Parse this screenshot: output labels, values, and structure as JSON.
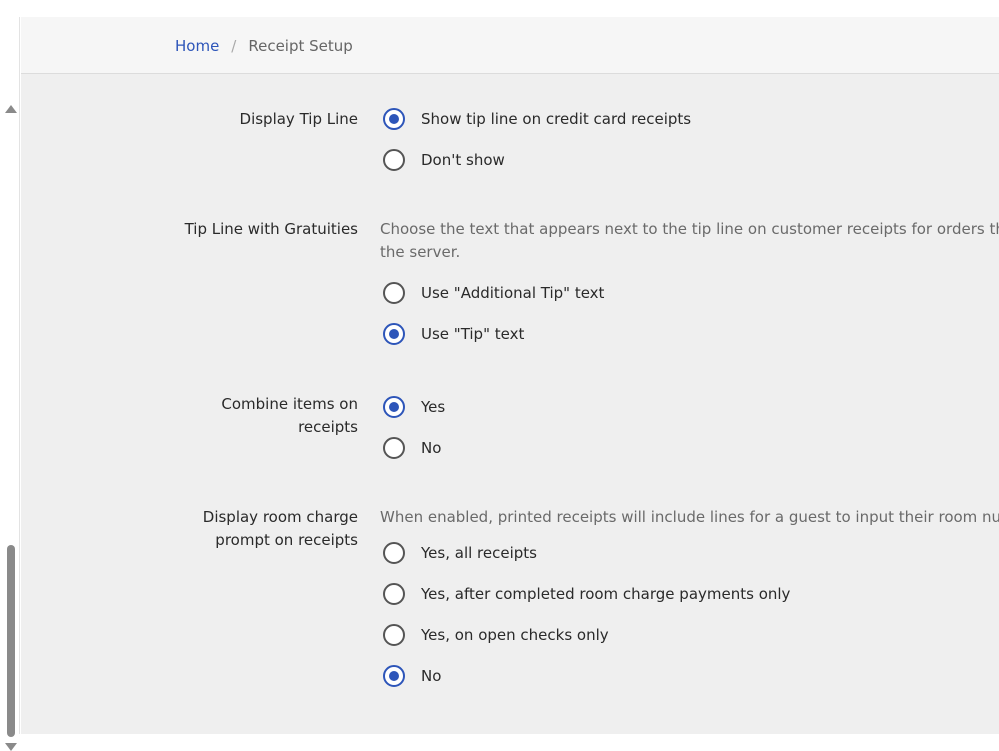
{
  "breadcrumb": {
    "home": "Home",
    "separator": "/",
    "current": "Receipt Setup"
  },
  "settings": {
    "tip_line": {
      "label": "Display Tip Line",
      "options": [
        {
          "label": "Show tip line on credit card receipts",
          "checked": true
        },
        {
          "label": "Don't show",
          "checked": false
        }
      ]
    },
    "gratuities": {
      "label": "Tip Line with Gratuities",
      "description_line1": "Choose the text that appears next to the tip line on customer receipts for orders that",
      "description_line2": "the server.",
      "options": [
        {
          "label": "Use \"Additional Tip\" text",
          "checked": false
        },
        {
          "label": "Use \"Tip\" text",
          "checked": true
        }
      ]
    },
    "combine": {
      "label_line1": "Combine items on",
      "label_line2": "receipts",
      "options": [
        {
          "label": "Yes",
          "checked": true
        },
        {
          "label": "No",
          "checked": false
        }
      ]
    },
    "room_charge": {
      "label_line1": "Display room charge",
      "label_line2": "prompt on receipts",
      "description": "When enabled, printed receipts will include lines for a guest to input their room numb",
      "options": [
        {
          "label": "Yes, all receipts",
          "checked": false
        },
        {
          "label": "Yes, after completed room charge payments only",
          "checked": false
        },
        {
          "label": "Yes, on open checks only",
          "checked": false
        },
        {
          "label": "No",
          "checked": true
        }
      ]
    }
  },
  "colors": {
    "accent": "#2d55b9",
    "background": "#efefef"
  }
}
